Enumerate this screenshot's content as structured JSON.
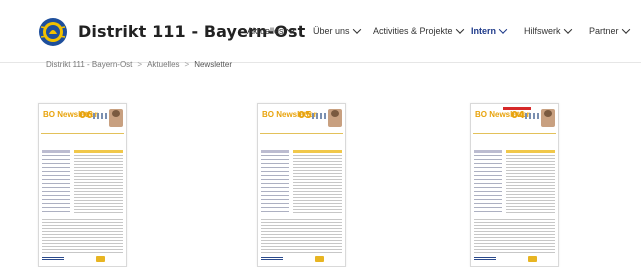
{
  "header": {
    "site_title": "Distrikt 111 - Bayern-Ost",
    "logo_icon": "lions-club-logo-icon"
  },
  "nav": {
    "items": [
      {
        "label": "Aktuelles"
      },
      {
        "label": "Über uns"
      },
      {
        "label": "Activities & Projekte"
      },
      {
        "label": "Intern",
        "active": true
      },
      {
        "label": "Hilfswerk"
      },
      {
        "label": "Partner"
      }
    ]
  },
  "breadcrumb": {
    "home": "Distrikt 111 - Bayern-Ost",
    "section": "Aktuelles",
    "current": "Newsletter",
    "separator": ">"
  },
  "newsletters": [
    {
      "issue": "06",
      "brand": "BO Newsletter"
    },
    {
      "issue": "05",
      "brand": "BO Newsletter"
    },
    {
      "issue": "04",
      "brand": "BO Newsletter"
    }
  ],
  "colors": {
    "accent_gold": "#e8a30c",
    "nav_active": "#1e3a8a",
    "lions_blue": "#1e4f9c"
  }
}
